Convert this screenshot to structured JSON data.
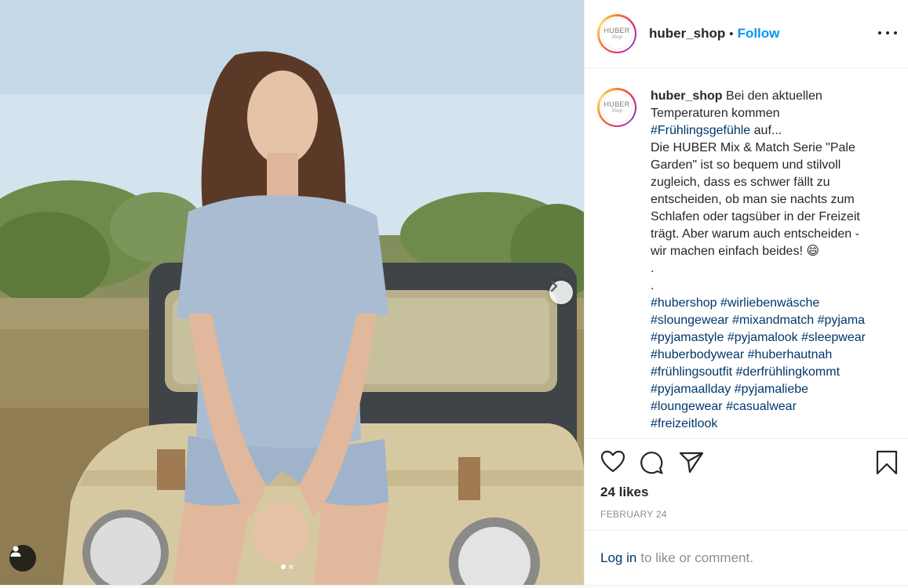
{
  "header": {
    "username": "huber_shop",
    "separator": "•",
    "follow_label": "Follow",
    "logo_text": "HUBER",
    "logo_sub": "Shop"
  },
  "icons": {
    "more": "more-options-icon",
    "next": "chevron-right-icon",
    "user_tag": "user-tag-icon",
    "like": "heart-icon",
    "comment": "comment-bubble-icon",
    "share": "paper-plane-icon",
    "save": "bookmark-icon"
  },
  "caption": {
    "username": "huber_shop",
    "line1": "Bei den aktuellen",
    "line2": "Temperaturen kommen",
    "hashtag_fruehling": "#Frühlingsgefühle",
    "line3_rest": " auf...",
    "line4": "Die HUBER Mix & Match Serie \"Pale",
    "line5": "Garden\" ist so bequem und stilvoll",
    "line6": "zugleich, dass es schwer fällt zu",
    "line7": "entscheiden, ob man sie nachts zum",
    "line8": "Schlafen oder tagsüber in der Freizeit",
    "line9": "trägt. Aber warum auch entscheiden -",
    "line10": "wir machen einfach beides!",
    "emoji": "😄",
    "dot1": ".",
    "dot2": ".",
    "hashtags": [
      [
        "#hubershop",
        "#wirliebenwäsche"
      ],
      [
        "#sloungewear",
        "#mixandmatch",
        "#pyjama"
      ],
      [
        "#pyjamastyle",
        "#pyjamalook",
        "#sleepwear"
      ],
      [
        "#huberbodywear",
        "#huberhautnah"
      ],
      [
        "#frühlingsoutfit",
        "#derfrühlingkommt"
      ],
      [
        "#pyjamaallday",
        "#pyjamaliebe"
      ],
      [
        "#loungewear",
        "#casualwear"
      ],
      [
        "#freizeitlook"
      ]
    ]
  },
  "stats": {
    "likes": "24 likes",
    "date": "FEBRUARY 24"
  },
  "login": {
    "link": "Log in",
    "rest": "to like or comment."
  },
  "carousel": {
    "total": 2,
    "current": 1
  },
  "colors": {
    "follow": "#0095f6",
    "hashtag": "#00376b",
    "muted": "#8e8e8e",
    "border": "#efefef"
  }
}
